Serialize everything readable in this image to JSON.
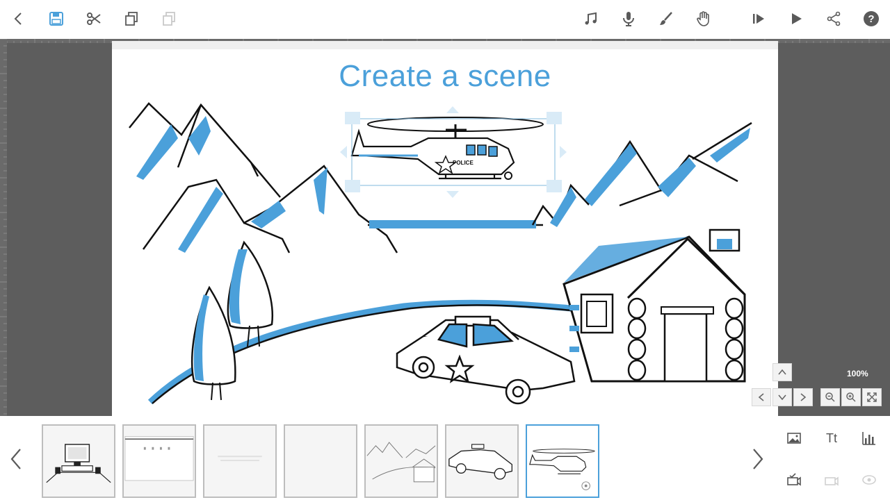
{
  "toolbar": {
    "left": [
      "back-icon",
      "save-icon",
      "cut-icon",
      "copy-icon",
      "paste-icon"
    ],
    "right": [
      "music-icon",
      "microphone-icon",
      "brush-icon",
      "hand-icon",
      "play-from-here-icon",
      "play-icon",
      "share-icon",
      "help-icon"
    ],
    "help_label": "?"
  },
  "canvas": {
    "title": "Create a scene",
    "selected_object": "helicopter",
    "helicopter_label": "POLICE"
  },
  "view": {
    "zoom": "100%"
  },
  "thumbnails": [
    {
      "name": "computer-desk",
      "active": false
    },
    {
      "name": "chart-slide",
      "active": false
    },
    {
      "name": "blank-text-slide",
      "active": false
    },
    {
      "name": "blank-slide",
      "active": false
    },
    {
      "name": "mountain-cabin",
      "active": false
    },
    {
      "name": "police-car",
      "active": false
    },
    {
      "name": "helicopter",
      "active": true
    }
  ],
  "side_tools": {
    "text_label": "Tt"
  },
  "colors": {
    "accent": "#4ba0da",
    "workarea": "#5d5d5d",
    "icon": "#5a5a5a"
  }
}
